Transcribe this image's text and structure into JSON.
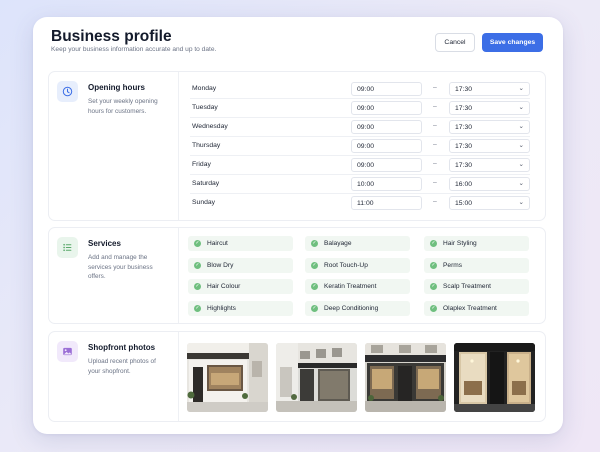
{
  "header": {
    "title": "Business profile",
    "subtitle": "Keep your business information accurate and up to date.",
    "cancel_label": "Cancel",
    "save_label": "Save changes"
  },
  "opening_hours": {
    "title": "Opening hours",
    "description": "Set your weekly opening hours for customers.",
    "separator": "–",
    "rows": [
      {
        "day": "Monday",
        "open": "09:00",
        "close": "17:30"
      },
      {
        "day": "Tuesday",
        "open": "09:00",
        "close": "17:30"
      },
      {
        "day": "Wednesday",
        "open": "09:00",
        "close": "17:30"
      },
      {
        "day": "Thursday",
        "open": "09:00",
        "close": "17:30"
      },
      {
        "day": "Friday",
        "open": "09:00",
        "close": "17:30"
      },
      {
        "day": "Saturday",
        "open": "10:00",
        "close": "16:00"
      },
      {
        "day": "Sunday",
        "open": "11:00",
        "close": "15:00"
      }
    ]
  },
  "services": {
    "title": "Services",
    "description": "Add and manage the services your business offers.",
    "items": [
      "Haircut",
      "Balayage",
      "Hair Styling",
      "Blow Dry",
      "Root Touch-Up",
      "Perms",
      "Hair Colour",
      "Keratin Treatment",
      "Scalp Treatment",
      "Highlights",
      "Deep Conditioning",
      "Olaplex Treatment"
    ]
  },
  "photos": {
    "title": "Shopfront photos",
    "description": "Upload recent photos of your shopfront."
  },
  "colors": {
    "accent": "#3c6ee6",
    "check": "#6fbf7f",
    "chip_bg": "#f1f7f2"
  },
  "icons": {
    "hours": "clock-icon",
    "services": "list-icon",
    "photos": "image-icon",
    "service_item": "check-circle-icon",
    "time_select": "chevron-down-icon"
  }
}
